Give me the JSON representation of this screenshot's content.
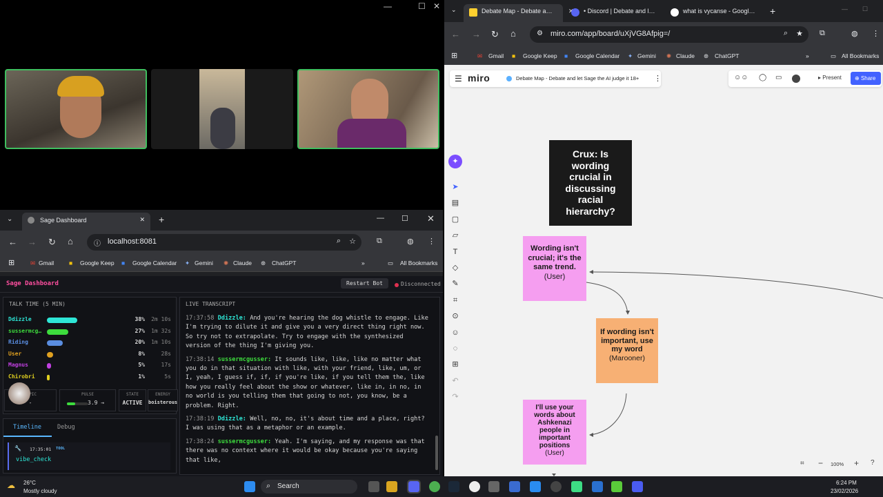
{
  "video": {
    "controls": [
      "—",
      "☐",
      "✕"
    ]
  },
  "dash_browser": {
    "tab_title": "Sage Dashboard",
    "url": "localhost:8081",
    "bookmarks": [
      "Gmail",
      "Google Keep",
      "Google Calendar",
      "Gemini",
      "Claude",
      "ChatGPT"
    ],
    "all_bookmarks": "All Bookmarks"
  },
  "sage": {
    "title": "Sage Dashboard",
    "restart_label": "Restart Bot",
    "status": "Disconnected",
    "talk_time_title": "TALK TIME (5 MIN)",
    "speakers": [
      {
        "name": "Ddizzle",
        "pct": "38%",
        "time": "2m 10s",
        "fill": 0.38,
        "color": "#2ee6d6"
      },
      {
        "name": "sussermcg…",
        "pct": "27%",
        "time": "1m 32s",
        "fill": 0.27,
        "color": "#3ddc3d"
      },
      {
        "name": "Riding",
        "pct": "20%",
        "time": "1m 10s",
        "fill": 0.2,
        "color": "#5a8de0"
      },
      {
        "name": "User",
        "pct": "8%",
        "time": "28s",
        "fill": 0.08,
        "color": "#e0a020"
      },
      {
        "name": "Magnus",
        "pct": "5%",
        "time": "17s",
        "fill": 0.05,
        "color": "#c040e0"
      },
      {
        "name": "Chirobri",
        "pct": "1%",
        "time": "5s",
        "fill": 0.01,
        "color": "#e0d020"
      }
    ],
    "stats": [
      {
        "label": "TOPIC",
        "value": "-"
      },
      {
        "label": "PULSE",
        "value": "3.9 →"
      },
      {
        "label": "STATE",
        "value": "ACTIVE"
      },
      {
        "label": "ENERGY",
        "value": "boisterous"
      }
    ],
    "tabs": [
      "Timeline",
      "Debug"
    ],
    "timeline_item": {
      "time": "17:35:01",
      "tag": "TOOL",
      "name": "vibe_check"
    },
    "transcript_title": "LIVE TRANSCRIPT",
    "transcript": [
      {
        "ts": "17:37:58",
        "speaker": "Ddizzle:",
        "color": "#2ee6d6",
        "text": "And you're hearing the dog whistle to engage. Like I'm trying to dilute it and give you a very direct thing right now. So try not to extrapolate. Try to engage with the synthesized version of the thing I'm giving you."
      },
      {
        "ts": "17:38:14",
        "speaker": "sussermcgusser:",
        "color": "#3ddc3d",
        "text": "It sounds like, like, like no matter what you do in that situation with like, with your friend, like, um, or I, yeah, I guess if, if, if you're like, if you tell them the, like how you really feel about the show or whatever, like in, in no, in no world is you telling them that going to not, you know, be a problem. Right."
      },
      {
        "ts": "17:38:19",
        "speaker": "Ddizzle:",
        "color": "#2ee6d6",
        "text": "Well, no, no, it's about time and a place, right? I was using that as a metaphor or an example."
      },
      {
        "ts": "17:38:24",
        "speaker": "sussermcgusser:",
        "color": "#3ddc3d",
        "text": "Yeah. I'm saying, and my response was that there was no context where it would be okay because you're saying that like,"
      }
    ]
  },
  "miro_browser": {
    "tabs": [
      "Debate Map - Debate a…",
      "• Discord | Debate and l…",
      "what is vycanse - Googl…"
    ],
    "url": "miro.com/app/board/uXjVG8Afpig=/",
    "bookmarks": [
      "Gmail",
      "Google Keep",
      "Google Calendar",
      "Gemini",
      "Claude",
      "ChatGPT"
    ],
    "all_bookmarks": "All Bookmarks",
    "logo": "miro",
    "board_title": "Debate Map - Debate and let Sage the AI judge it 18+",
    "present": "Present",
    "share": "Share",
    "zoom": "100%",
    "cards": {
      "crux": "Crux: Is wording crucial in discussing racial hierarchy?",
      "card1": {
        "text": "Wording isn't crucial; it's the same trend.",
        "author": "(User)"
      },
      "card2": {
        "text": "If wording isn't important, use my word",
        "author": "(Marooner)"
      },
      "card3": {
        "text": "I'll use your words about Ashkenazi people in important positions",
        "author": "(User)"
      }
    }
  },
  "taskbar": {
    "temp": "26°C",
    "weather": "Mostly cloudy",
    "search": "Search",
    "time": "6:24 PM",
    "date": "23/02/2026"
  }
}
